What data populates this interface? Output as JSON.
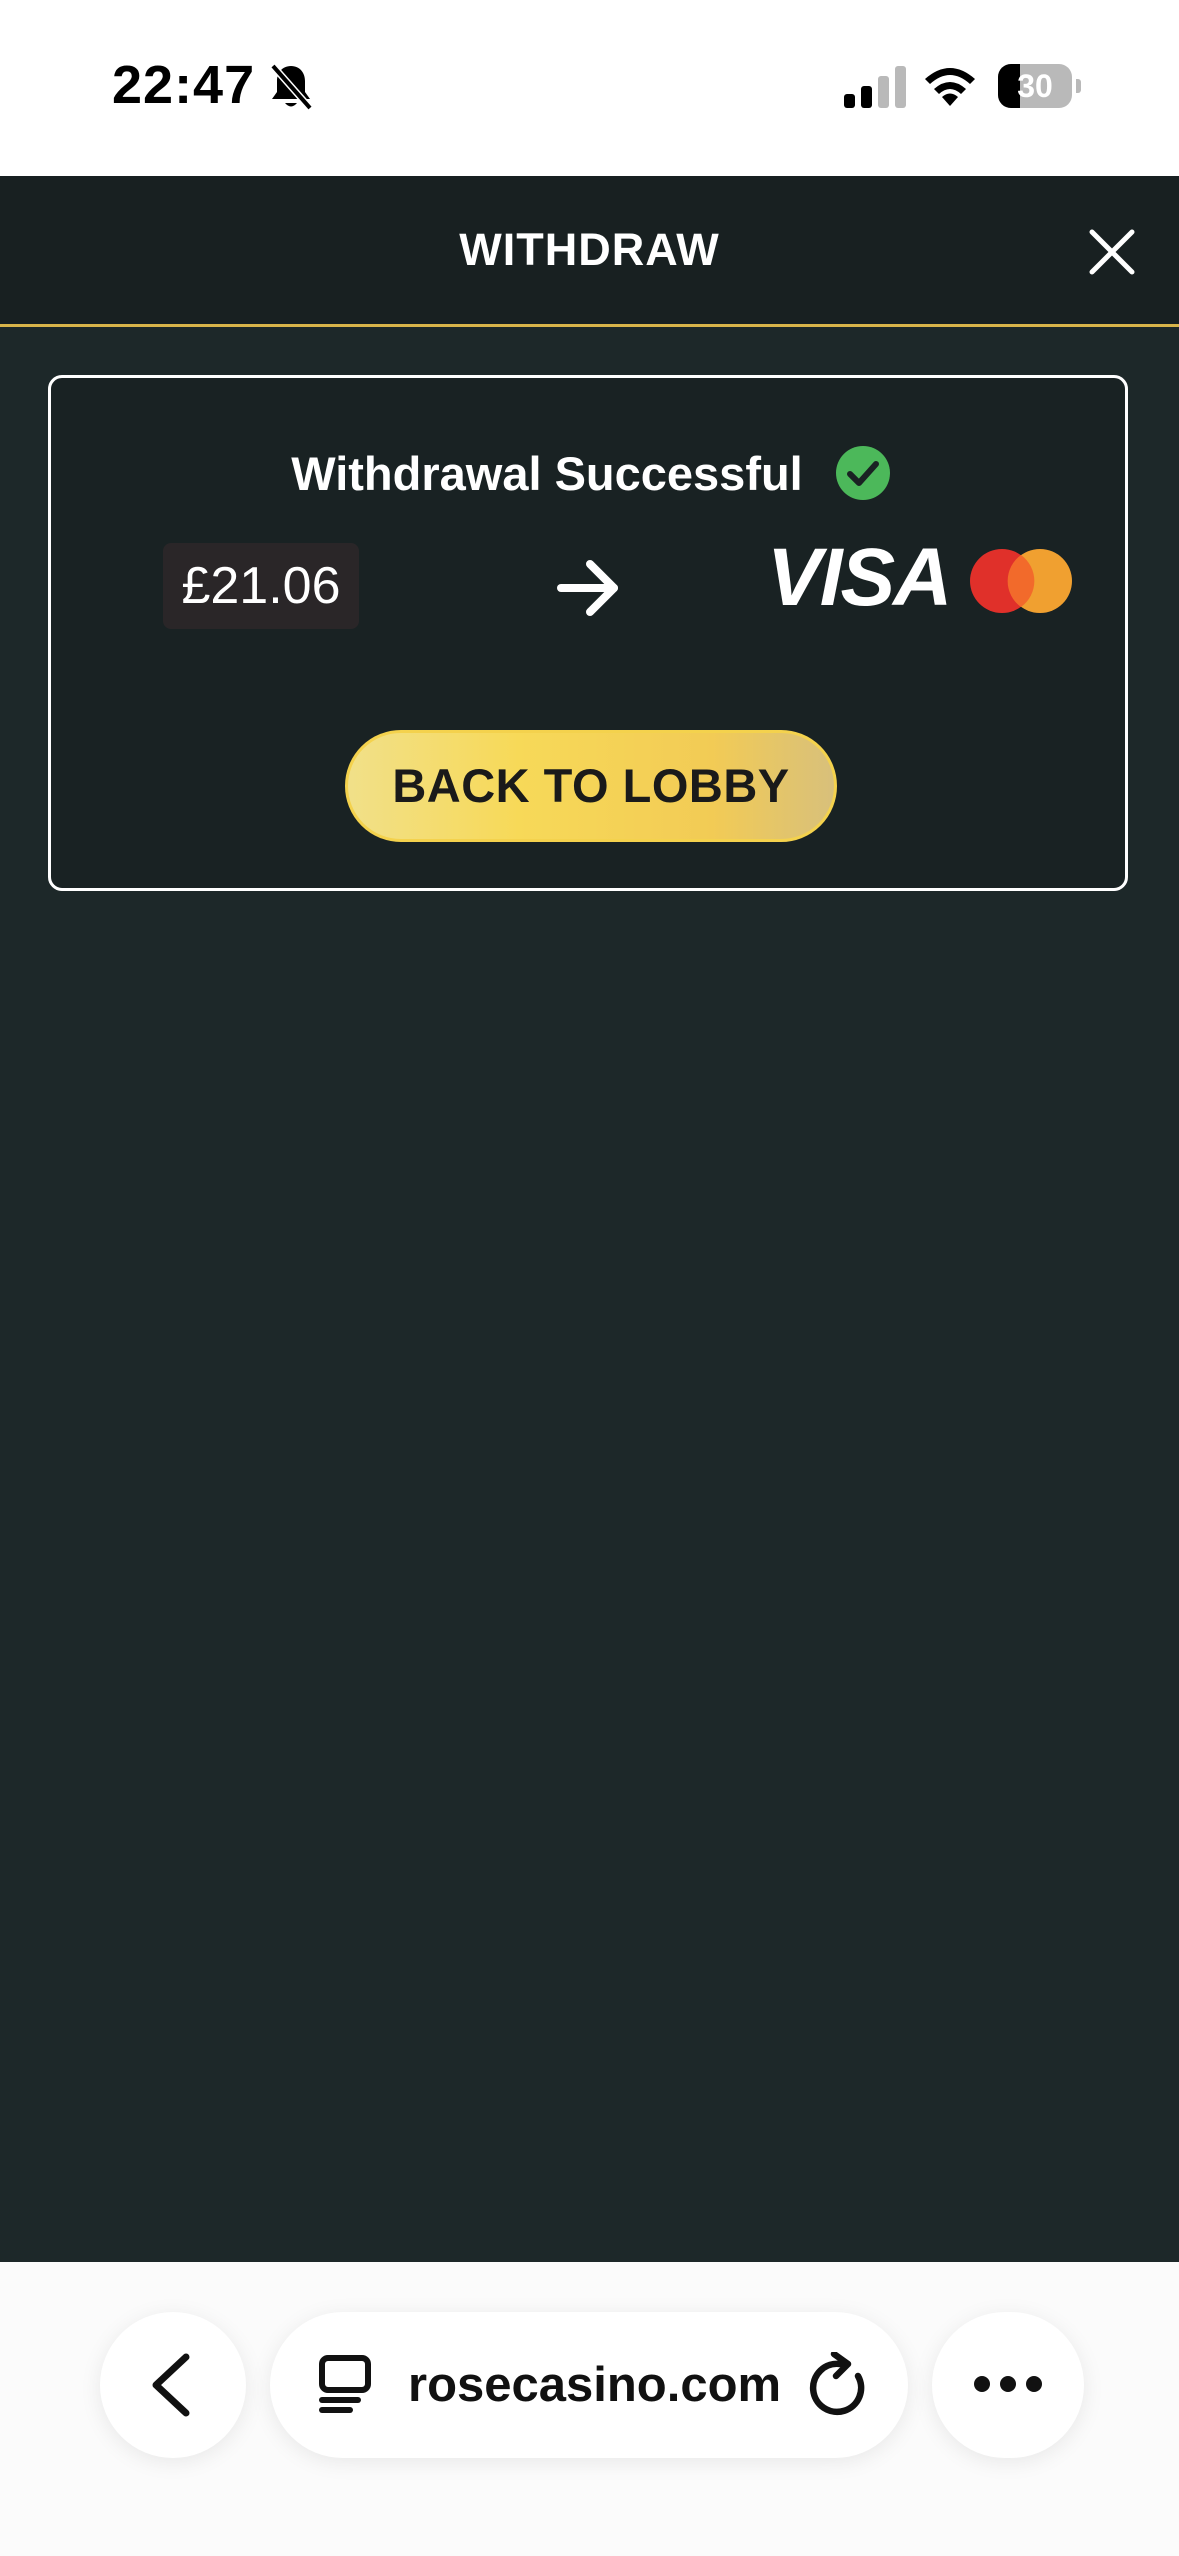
{
  "status_bar": {
    "time": "22:47",
    "battery_level": 30,
    "battery_label": "30",
    "icons": [
      "bell-slash-icon",
      "cellular-signal-icon",
      "wifi-icon",
      "battery-icon"
    ]
  },
  "header": {
    "title": "WITHDRAW",
    "close_icon": "close-icon"
  },
  "result": {
    "title": "Withdrawal Successful",
    "status_icon": "check-circle-icon",
    "amount": "£21.06",
    "arrow_icon": "arrow-right-icon",
    "payment_brand_visa": "VISA",
    "payment_brand_mastercard_icon": "mastercard-logo",
    "back_button_label": "BACK TO LOBBY"
  },
  "browser": {
    "url": "rosecasino.com",
    "back_icon": "chevron-left-icon",
    "tabs_icon": "tabs-icon",
    "reload_icon": "reload-icon",
    "more_icon": "more-horizontal-icon"
  },
  "colors": {
    "app_background": "#1d2829",
    "header_background": "#182021",
    "accent_gold": "#d8b44a",
    "success_green": "#4cb85a",
    "button_yellow": "#f7d958",
    "mastercard_red": "#e0302a",
    "mastercard_orange": "#f0a030"
  }
}
